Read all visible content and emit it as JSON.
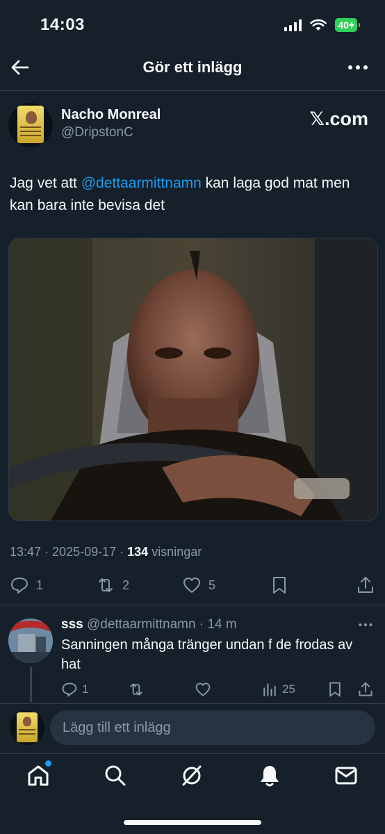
{
  "status_bar": {
    "time": "14:03",
    "battery": "40"
  },
  "header": {
    "title": "Gör ett inlägg"
  },
  "tweet": {
    "author_name": "Nacho Monreal",
    "author_handle": "@DripstonC",
    "brand": "𝕏.com",
    "text_before": "Jag vet att ",
    "mention": "@dettaarmittnamn",
    "text_after": " kan laga god mat men kan bara inte bevisa det",
    "time": "13:47",
    "date": "2025-09-17",
    "views_count": "134",
    "views_label": "visningar",
    "reply_count": "1",
    "retweet_count": "2",
    "like_count": "5"
  },
  "reply": {
    "author_name": "sss",
    "author_handle": "@dettaarmittnamn",
    "age": "14 m",
    "text": "Sanningen många tränger undan f de frodas av hat",
    "reply_count": "1",
    "views_count": "25"
  },
  "compose": {
    "placeholder": "Lägg till ett inlägg"
  },
  "colors": {
    "background": "#15202b",
    "accent": "#1d9bf0",
    "muted": "#8b98a5",
    "battery": "#30d158"
  },
  "icons": [
    "back-arrow-icon",
    "more-icon",
    "reply-icon",
    "retweet-icon",
    "like-icon",
    "bookmark-icon",
    "share-icon",
    "views-icon",
    "home-icon",
    "search-icon",
    "grok-icon",
    "notifications-icon",
    "messages-icon"
  ]
}
